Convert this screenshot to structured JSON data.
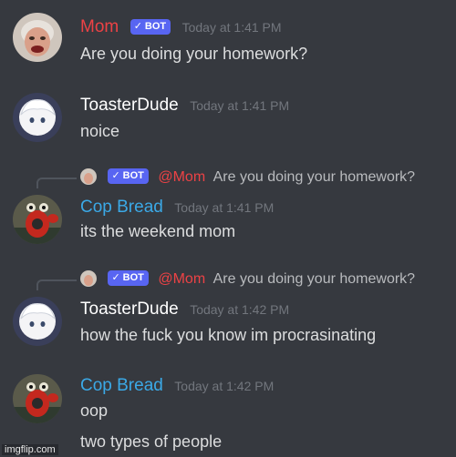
{
  "messages": [
    {
      "author": "Mom",
      "bot_label": "BOT",
      "time": "Today at 1:41 PM",
      "lines": [
        "Are you doing your homework?"
      ]
    },
    {
      "author": "ToasterDude",
      "time": "Today at 1:41 PM",
      "lines": [
        "noice"
      ]
    },
    {
      "reply": {
        "bot_label": "BOT",
        "mention": "@Mom",
        "text": "Are you doing your homework?"
      },
      "author": "Cop Bread",
      "time": "Today at 1:41 PM",
      "lines": [
        "its the weekend mom"
      ]
    },
    {
      "reply": {
        "bot_label": "BOT",
        "mention": "@Mom",
        "text": "Are you doing your homework?"
      },
      "author": "ToasterDude",
      "time": "Today at 1:42 PM",
      "lines": [
        "how the fuck you know im procrasinating"
      ]
    },
    {
      "author": "Cop Bread",
      "time": "Today at 1:42 PM",
      "lines": [
        "oop",
        "two types of people"
      ]
    }
  ],
  "watermark": "imgflip.com",
  "colors": {
    "background": "#36393f",
    "mom_name": "#ed4245",
    "cop_name": "#3ba9e7",
    "toaster_name": "#ffffff",
    "bot_badge": "#5865f2"
  }
}
